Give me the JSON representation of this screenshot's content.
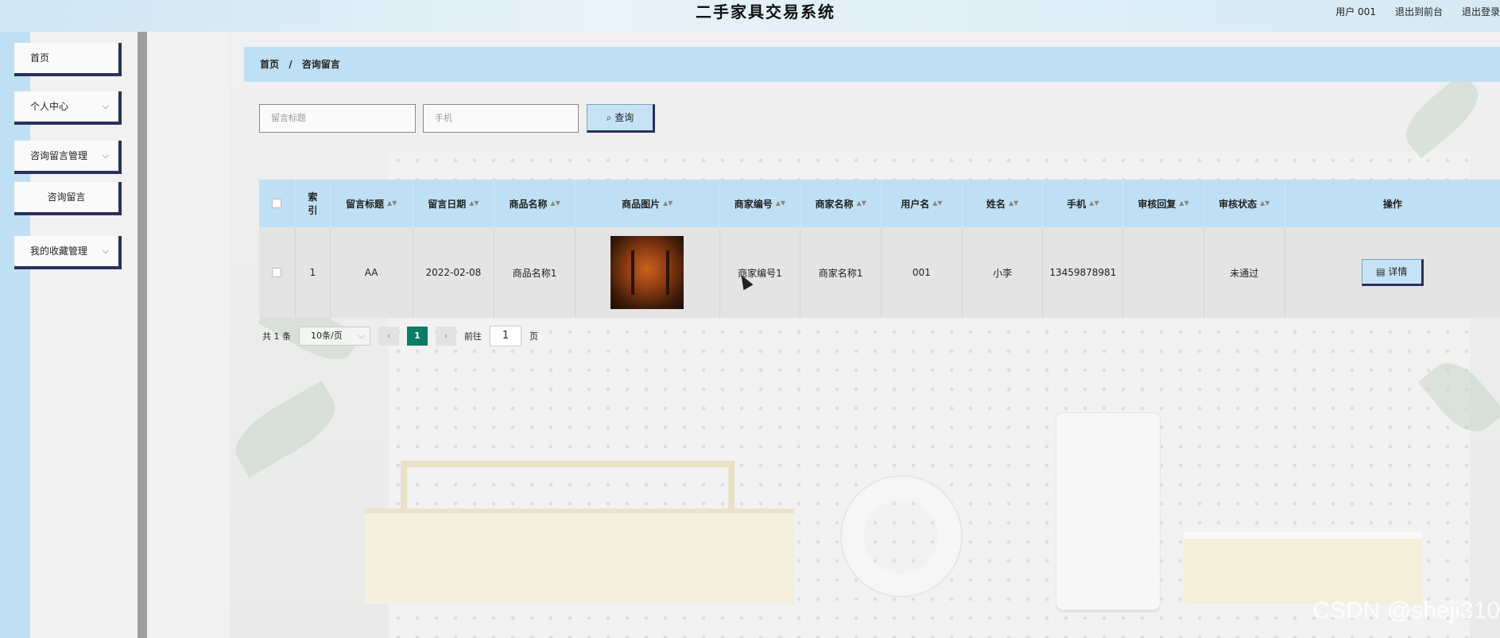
{
  "header": {
    "title": "二手家具交易系统",
    "user": "用户 001",
    "back_to_front": "退出到前台",
    "logout": "退出登录"
  },
  "sidebar": {
    "items": [
      {
        "label": "首页"
      },
      {
        "label": "个人中心"
      },
      {
        "label": "咨询留言管理"
      },
      {
        "label": "咨询留言"
      },
      {
        "label": "我的收藏管理"
      }
    ]
  },
  "breadcrumb": {
    "home": "首页",
    "sep": "/",
    "current": "咨询留言"
  },
  "search": {
    "title_placeholder": "留言标题",
    "phone_placeholder": "手机",
    "button": "查询",
    "button_icon": "search-icon"
  },
  "table": {
    "columns": [
      "索引",
      "留言标题",
      "留言日期",
      "商品名称",
      "商品图片",
      "商家编号",
      "商家名称",
      "用户名",
      "姓名",
      "手机",
      "审核回复",
      "审核状态",
      "操作"
    ],
    "rows": [
      {
        "index": "1",
        "title": "AA",
        "date": "2022-02-08",
        "product": "商品名称1",
        "merchant_no": "商家编号1",
        "merchant_name": "商家名称1",
        "username": "001",
        "name": "小李",
        "phone": "13459878981",
        "reply": "",
        "status": "未通过",
        "action": "详情"
      }
    ]
  },
  "pager": {
    "total": "共 1 条",
    "page_size": "10条/页",
    "current_page": "1",
    "goto_label": "前往",
    "goto_value": "1",
    "page_unit": "页"
  },
  "watermark": "CSDN @sheji310"
}
